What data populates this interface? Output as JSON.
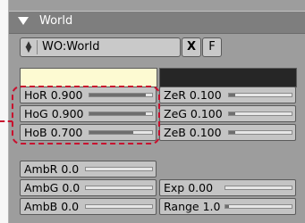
{
  "header": {
    "title": "World"
  },
  "world_field": {
    "value": "WO:World",
    "clear_label": "X",
    "fake_user_label": "F"
  },
  "swatches": {
    "horizon_color": "#fdfad2",
    "zenith_color": "#262626"
  },
  "horizon": [
    {
      "label": "HoR 0.900",
      "value": 0.9
    },
    {
      "label": "HoG 0.900",
      "value": 0.9
    },
    {
      "label": "HoB 0.700",
      "value": 0.7
    }
  ],
  "zenith": [
    {
      "label": "ZeR 0.100",
      "value": 0.1
    },
    {
      "label": "ZeG 0.100",
      "value": 0.1
    },
    {
      "label": "ZeB 0.100",
      "value": 0.1
    }
  ],
  "ambient": [
    {
      "label": "AmbR 0.0",
      "value": 0.0
    },
    {
      "label": "AmbG 0.0",
      "value": 0.0
    },
    {
      "label": "AmbB 0.0",
      "value": 0.0
    }
  ],
  "exposure": {
    "label": "Exp 0.00",
    "value": 0.0
  },
  "range": {
    "label": "Range 1.0",
    "value": 0.05
  }
}
